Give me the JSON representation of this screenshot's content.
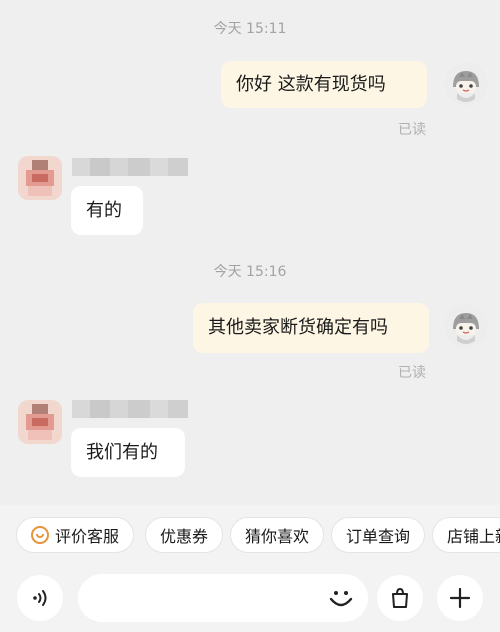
{
  "messages": {
    "time_1": "今天 15:11",
    "msg_1": "你好 这款有现货吗",
    "read_1": "已读",
    "msg_2": "有的",
    "time_2": "今天 15:16",
    "msg_3": "其他卖家断货确定有吗",
    "read_2": "已读",
    "msg_4": "我们有的"
  },
  "quick_actions": {
    "rate_service": "评价客服",
    "coupons": "优惠券",
    "guess_like": "猜你喜欢",
    "order_query": "订单查询",
    "shop_new": "店铺上新"
  },
  "input": {
    "placeholder": ""
  },
  "colors": {
    "outgoing_bubble": "#fdf6e4",
    "incoming_bubble": "#ffffff",
    "accent": "#e8933a"
  },
  "icons": {
    "voice": "voice-wave-icon",
    "emoji": "smile-face-icon",
    "shop": "shopping-bag-icon",
    "more": "plus-icon"
  }
}
